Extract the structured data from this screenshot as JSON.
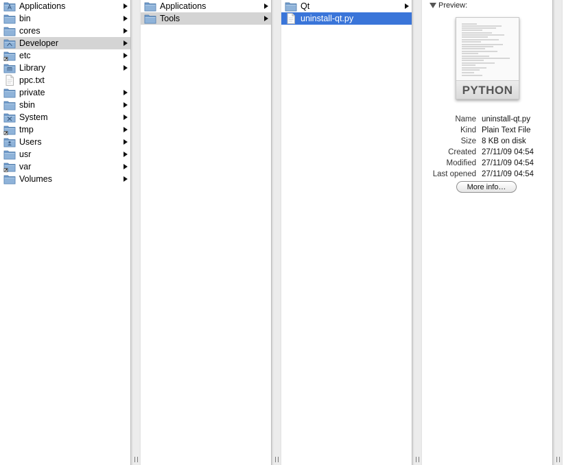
{
  "column1": {
    "items": [
      {
        "label": "Applications",
        "icon": "applications-folder-icon",
        "hasChildren": true
      },
      {
        "label": "bin",
        "icon": "folder-icon",
        "hasChildren": true
      },
      {
        "label": "cores",
        "icon": "folder-icon",
        "hasChildren": true
      },
      {
        "label": "Developer",
        "icon": "developer-folder-icon",
        "hasChildren": true,
        "selected": "gray"
      },
      {
        "label": "etc",
        "icon": "alias-folder-icon",
        "hasChildren": true
      },
      {
        "label": "Library",
        "icon": "library-folder-icon",
        "hasChildren": true
      },
      {
        "label": "ppc.txt",
        "icon": "text-file-icon",
        "hasChildren": false
      },
      {
        "label": "private",
        "icon": "folder-icon",
        "hasChildren": true
      },
      {
        "label": "sbin",
        "icon": "folder-icon",
        "hasChildren": true
      },
      {
        "label": "System",
        "icon": "system-folder-icon",
        "hasChildren": true
      },
      {
        "label": "tmp",
        "icon": "alias-folder-icon",
        "hasChildren": true
      },
      {
        "label": "Users",
        "icon": "users-folder-icon",
        "hasChildren": true
      },
      {
        "label": "usr",
        "icon": "folder-icon",
        "hasChildren": true
      },
      {
        "label": "var",
        "icon": "alias-folder-icon",
        "hasChildren": true
      },
      {
        "label": "Volumes",
        "icon": "folder-icon",
        "hasChildren": true
      }
    ]
  },
  "column2": {
    "items": [
      {
        "label": "Applications",
        "icon": "folder-icon",
        "hasChildren": true
      },
      {
        "label": "Tools",
        "icon": "folder-icon",
        "hasChildren": true,
        "selected": "gray"
      }
    ]
  },
  "column3": {
    "items": [
      {
        "label": "Qt",
        "icon": "folder-icon",
        "hasChildren": true
      },
      {
        "label": "uninstall-qt.py",
        "icon": "text-file-icon",
        "hasChildren": false,
        "selected": "blue"
      }
    ]
  },
  "preview": {
    "heading": "Preview:",
    "thumbnail_label": "PYTHON",
    "info": [
      {
        "key": "Name",
        "value": "uninstall-qt.py"
      },
      {
        "key": "Kind",
        "value": "Plain Text File"
      },
      {
        "key": "Size",
        "value": "8 KB on disk"
      },
      {
        "key": "Created",
        "value": "27/11/09 04:54"
      },
      {
        "key": "Modified",
        "value": "27/11/09 04:54"
      },
      {
        "key": "Last opened",
        "value": "27/11/09 04:54"
      }
    ],
    "more_info_label": "More info…"
  },
  "colors": {
    "selection_blue": "#3a75d9",
    "selection_gray": "#d4d4d4",
    "folder_blue": "#8fb3d9"
  }
}
